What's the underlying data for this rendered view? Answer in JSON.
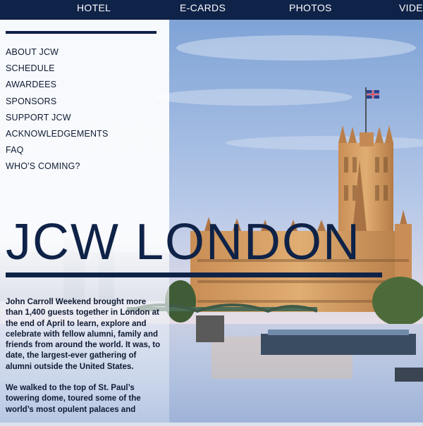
{
  "topnav": {
    "items": [
      {
        "label": "HOTEL"
      },
      {
        "label": "E-CARDS"
      },
      {
        "label": "PHOTOS"
      },
      {
        "label": "VIDEO"
      }
    ]
  },
  "sidebar": {
    "items": [
      {
        "label": "ABOUT JCW"
      },
      {
        "label": "SCHEDULE"
      },
      {
        "label": "AWARDEES"
      },
      {
        "label": "SPONSORS"
      },
      {
        "label": "SUPPORT JCW"
      },
      {
        "label": "ACKNOWLEDGEMENTS"
      },
      {
        "label": "FAQ"
      },
      {
        "label": "WHO'S COMING?"
      }
    ]
  },
  "hero": {
    "headline": "JCW LONDON"
  },
  "intro": {
    "paragraphs": [
      "John Carroll Weekend brought more than 1,400 guests together in London at the end of April to learn, explore and celebrate with fellow alumni, family and friends from around the world. It was, to date, the largest-ever gathering of alumni outside the United States.",
      "We walked to the top of St. Paul’s towering dome, toured some of the world’s most opulent palaces and"
    ]
  },
  "colors": {
    "navy": "#0f2247",
    "sky": "#9bb8e0",
    "water": "#b8cbe6",
    "stone": "#d9a564"
  }
}
